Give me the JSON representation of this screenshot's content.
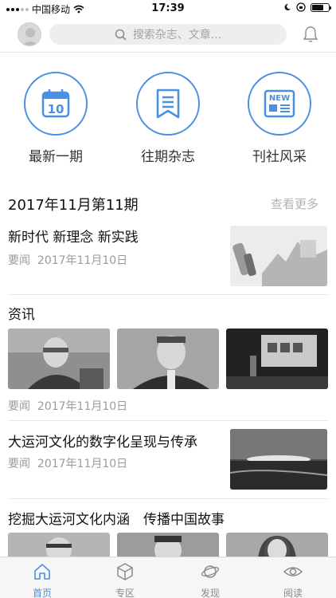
{
  "status_bar": {
    "carrier": "中国移动",
    "time": "17:39"
  },
  "header": {
    "search_placeholder": "搜索杂志、文章..."
  },
  "quick_links": [
    {
      "label": "最新一期",
      "icon": "calendar-icon",
      "day": "10"
    },
    {
      "label": "往期杂志",
      "icon": "bookmark-icon"
    },
    {
      "label": "刊社风采",
      "icon": "news-icon",
      "badge": "NEW"
    }
  ],
  "issue": {
    "title": "2017年11月第11期",
    "more": "查看更多"
  },
  "articles": [
    {
      "title": "新时代 新理念 新实践",
      "category": "要闻",
      "date": "2017年11月10日"
    },
    {
      "title": "资讯",
      "category": "要闻",
      "date": "2017年11月10日"
    },
    {
      "title": "大运河文化的数字化呈现与传承",
      "category": "要闻",
      "date": "2017年11月10日"
    },
    {
      "title": "挖掘大运河文化内涵　传播中国故事"
    }
  ],
  "tabs": [
    {
      "label": "首页",
      "icon": "home-icon",
      "active": true
    },
    {
      "label": "专区",
      "icon": "cube-icon"
    },
    {
      "label": "发现",
      "icon": "planet-icon"
    },
    {
      "label": "阅读",
      "icon": "eye-icon"
    }
  ],
  "colors": {
    "accent": "#4a90e2",
    "muted": "#9b9b9b"
  }
}
